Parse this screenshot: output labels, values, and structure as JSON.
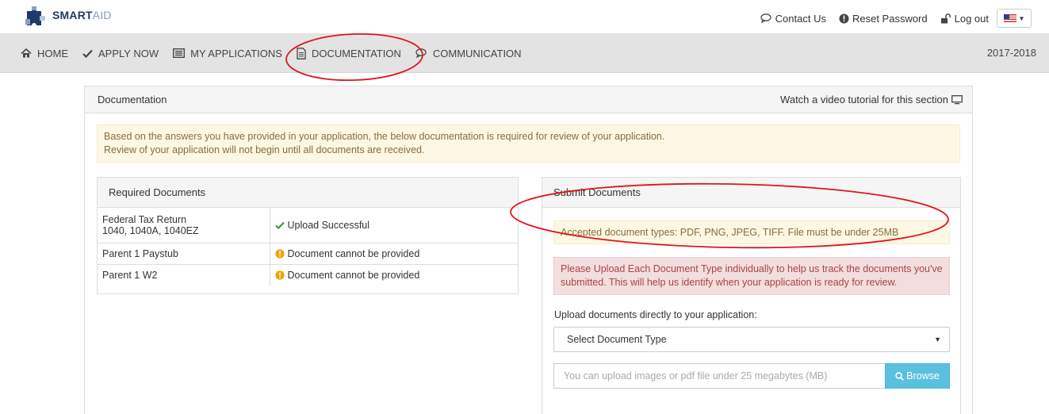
{
  "brand": {
    "name_bold": "SMART",
    "name_light": "AID"
  },
  "toplinks": [
    {
      "label": "Contact Us",
      "icon": "chat-icon"
    },
    {
      "label": "Reset Password",
      "icon": "info-circle-icon"
    },
    {
      "label": "Log out",
      "icon": "unlock-icon"
    }
  ],
  "language": {
    "icon": "us-flag-icon"
  },
  "nav": {
    "items": [
      {
        "label": "HOME",
        "icon": "home-icon"
      },
      {
        "label": "APPLY NOW",
        "icon": "check-icon"
      },
      {
        "label": "MY APPLICATIONS",
        "icon": "list-icon"
      },
      {
        "label": "DOCUMENTATION",
        "icon": "document-icon"
      },
      {
        "label": "COMMUNICATION",
        "icon": "chat-icon"
      }
    ],
    "year": "2017-2018"
  },
  "panel": {
    "title": "Documentation",
    "video_link": "Watch a video tutorial for this section"
  },
  "notice": {
    "line1": "Based on the answers you have provided in your application, the below documentation is required for review of your application.",
    "line2": "Review of your application will not begin until all documents are received."
  },
  "required": {
    "title": "Required Documents",
    "rows": [
      {
        "doc_line1": "Federal Tax Return",
        "doc_line2": "1040, 1040A, 1040EZ",
        "status": "Upload Successful",
        "status_type": "success"
      },
      {
        "doc_line1": "Parent 1 Paystub",
        "doc_line2": "",
        "status": "Document cannot be provided",
        "status_type": "warning"
      },
      {
        "doc_line1": "Parent 1 W2",
        "doc_line2": "",
        "status": "Document cannot be provided",
        "status_type": "warning"
      }
    ]
  },
  "submit": {
    "title": "Submit Documents",
    "accepted": "Accepted document types: PDF, PNG, JPEG, TIFF. File must be under 25MB",
    "warning_line1": "Please Upload Each Document Type individually to help us track the documents you've",
    "warning_line2": "submitted. This will help us identify when your application is ready for review.",
    "upload_label": "Upload documents directly to your application:",
    "select_value": "Select Document Type",
    "file_placeholder": "You can upload images or pdf file under 25 megabytes (MB)",
    "browse_label": "Browse"
  },
  "colors": {
    "nav_bg": "#e3e3e3",
    "success": "#3c9a3c",
    "warning": "#f0a30a",
    "browse": "#5bc0de",
    "annotation": "#e0141e"
  }
}
